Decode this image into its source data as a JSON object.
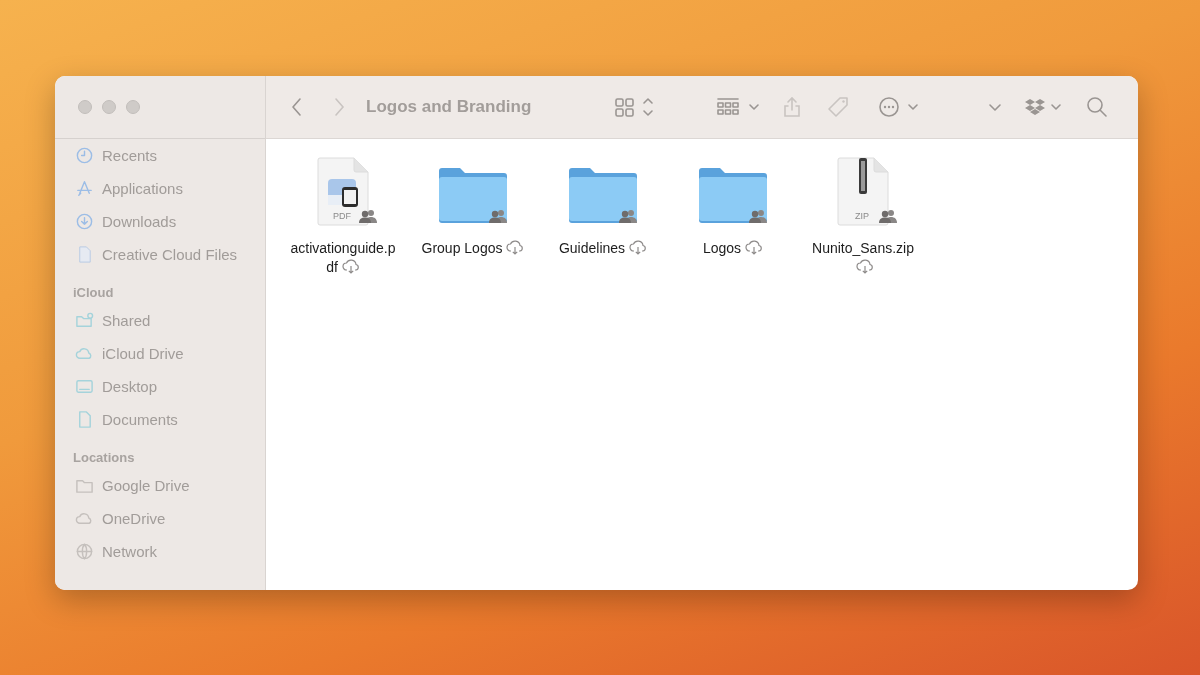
{
  "window": {
    "title": "Logos and Branding"
  },
  "sidebar": {
    "sections": [
      {
        "items": [
          {
            "label": "Recents"
          },
          {
            "label": "Applications"
          },
          {
            "label": "Downloads"
          },
          {
            "label": "Creative Cloud Files"
          }
        ]
      },
      {
        "header": "iCloud",
        "items": [
          {
            "label": "Shared"
          },
          {
            "label": "iCloud Drive"
          },
          {
            "label": "Desktop"
          },
          {
            "label": "Documents"
          }
        ]
      },
      {
        "header": "Locations",
        "items": [
          {
            "label": "Google Drive"
          },
          {
            "label": "OneDrive"
          },
          {
            "label": "Network"
          }
        ]
      }
    ]
  },
  "files": [
    {
      "name": "activationguide.pdf",
      "kind": "pdf",
      "badge": "PDF",
      "shared": true,
      "in_cloud": true
    },
    {
      "name": "Group Logos",
      "kind": "folder",
      "shared": true,
      "in_cloud": true
    },
    {
      "name": "Guidelines",
      "kind": "folder",
      "shared": true,
      "in_cloud": true
    },
    {
      "name": "Logos",
      "kind": "folder",
      "shared": true,
      "in_cloud": true
    },
    {
      "name": "Nunito_Sans.zip",
      "kind": "zip",
      "badge": "ZIP",
      "shared": true,
      "in_cloud": true
    }
  ]
}
